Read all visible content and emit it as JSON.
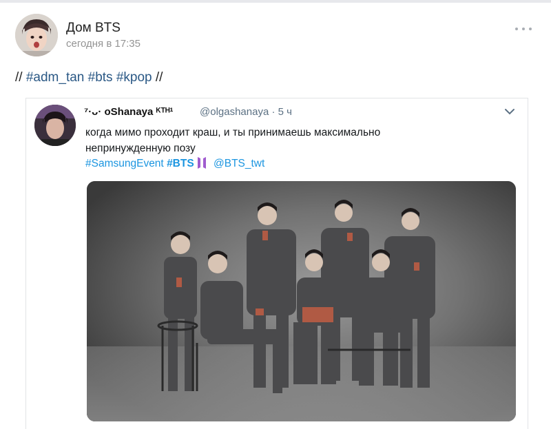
{
  "post": {
    "group_name": "Дом BTS",
    "time": "сегодня в 17:35",
    "text": {
      "prefix": "// ",
      "hashtags": [
        "#adm_tan",
        "#bts",
        "#kpop"
      ],
      "suffix": " //"
    }
  },
  "tweet": {
    "display_name": "⁷·ᴗ· oShanaya ᴷᵀᴴ¹",
    "handle": "@olgashanaya",
    "separator": "·",
    "age": "5 ч",
    "text": "когда мимо проходит краш, и ты принимаешь максимально непринужденную позу",
    "tag_samsung": "#SamsungEvent",
    "tag_bts": "#BTS",
    "mention": "@BTS_twt"
  },
  "icons": {
    "more": "more-horizontal-icon",
    "chevron": "chevron-down-icon",
    "bts_logo": "bts-logo-icon"
  },
  "colors": {
    "link": "#2a5885",
    "twitter_blue": "#1b95e0",
    "bts_purple": "#a05ccf"
  }
}
